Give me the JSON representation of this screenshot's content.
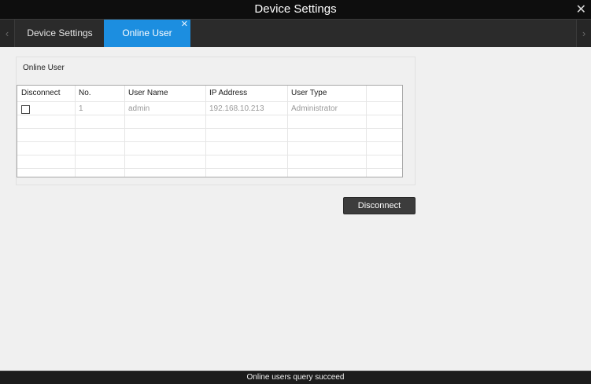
{
  "window": {
    "title": "Device Settings"
  },
  "tabs": [
    {
      "label": "Device Settings",
      "active": false
    },
    {
      "label": "Online User",
      "active": true
    }
  ],
  "group": {
    "title": "Online User"
  },
  "table": {
    "columns": [
      "Disconnect",
      "No.",
      "User Name",
      "IP Address",
      "User Type"
    ],
    "rows": [
      {
        "checked": false,
        "no": "1",
        "user_name": "admin",
        "ip": "192.168.10.213",
        "user_type": "Administrator"
      }
    ]
  },
  "actions": {
    "disconnect_label": "Disconnect"
  },
  "status": {
    "text": "Online users query succeed"
  },
  "colors": {
    "accent": "#1c8ee0",
    "titlebar": "#0e0e0e",
    "panel": "#f0f0f0"
  }
}
